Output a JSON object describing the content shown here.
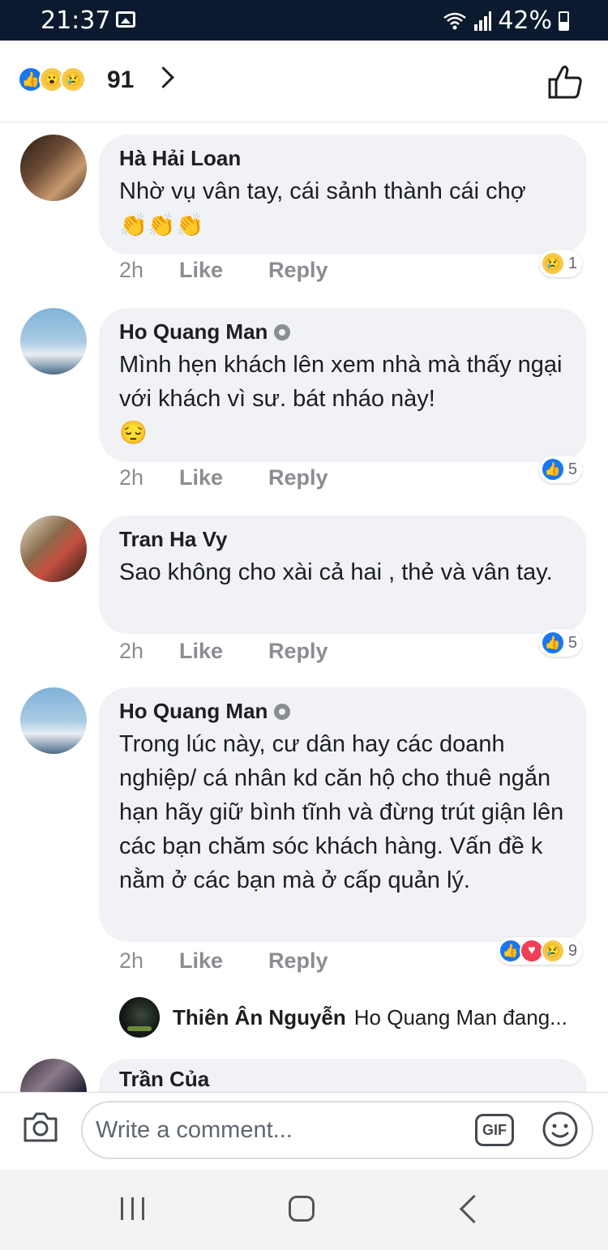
{
  "status_bar": {
    "time": "21:37",
    "battery": "42%"
  },
  "header": {
    "reaction_count": "91"
  },
  "comments": [
    {
      "author": "Hà Hải Loan",
      "verified": false,
      "text": "Nhờ vụ vân tay, cái sảnh thành cái chợ",
      "emoji": "👏👏👏",
      "time": "2h",
      "like_label": "Like",
      "reply_label": "Reply",
      "reaction_count": "1",
      "reactions": [
        "sad"
      ]
    },
    {
      "author": "Ho Quang Man",
      "verified": true,
      "text": "Mình hẹn khách lên xem nhà mà thấy ngại với khách vì sư. bát nháo này!",
      "emoji": "😔",
      "time": "2h",
      "like_label": "Like",
      "reply_label": "Reply",
      "reaction_count": "5",
      "reactions": [
        "like"
      ]
    },
    {
      "author": "Tran Ha Vy",
      "verified": false,
      "text": "Sao không cho xài cả hai , thẻ và vân tay.",
      "emoji": "",
      "time": "2h",
      "like_label": "Like",
      "reply_label": "Reply",
      "reaction_count": "5",
      "reactions": [
        "like"
      ]
    },
    {
      "author": "Ho Quang Man",
      "verified": true,
      "text": "Trong lúc này, cư dân hay các doanh nghiệp/ cá nhân kd căn hộ cho thuê ngắn hạn hãy giữ bình tĩnh và đừng trút giận lên các bạn chăm sóc khách hàng. Vấn đề k nằm ở các bạn mà ở cấp quản lý.",
      "emoji": "",
      "time": "2h",
      "like_label": "Like",
      "reply_label": "Reply",
      "reaction_count": "9",
      "reactions": [
        "like",
        "love",
        "sad"
      ]
    },
    {
      "author": "Trần Của"
    }
  ],
  "reply_preview": {
    "author": "Thiên Ân Nguyễn",
    "text": "Ho Quang Man đang..."
  },
  "composer": {
    "placeholder": "Write a comment...",
    "gif_label": "GIF"
  }
}
